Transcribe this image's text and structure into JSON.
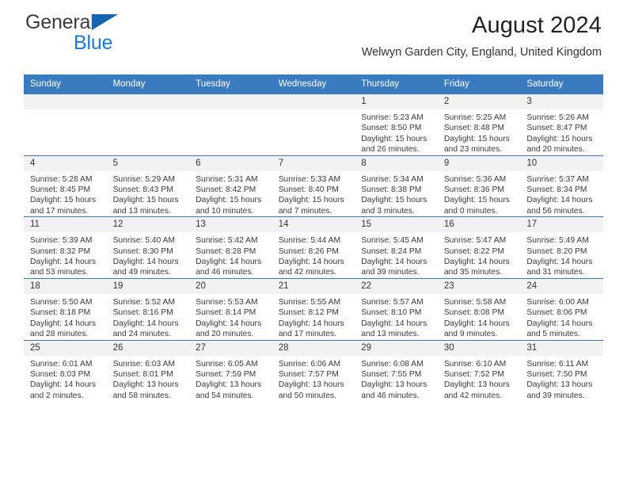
{
  "brand": {
    "word1": "General",
    "word2": "Blue",
    "flag_color": "#1565b0",
    "word2_color": "#1a7ad4"
  },
  "header": {
    "month_title": "August 2024",
    "location": "Welwyn Garden City, England, United Kingdom",
    "header_bg": "#3a7bbf"
  },
  "calendar": {
    "weekday_headers": [
      "Sunday",
      "Monday",
      "Tuesday",
      "Wednesday",
      "Thursday",
      "Friday",
      "Saturday"
    ],
    "weeks": [
      [
        {
          "day": "",
          "blank": true
        },
        {
          "day": "",
          "blank": true
        },
        {
          "day": "",
          "blank": true
        },
        {
          "day": "",
          "blank": true
        },
        {
          "day": "1",
          "sunrise": "Sunrise: 5:23 AM",
          "sunset": "Sunset: 8:50 PM",
          "daylight1": "Daylight: 15 hours",
          "daylight2": "and 26 minutes."
        },
        {
          "day": "2",
          "sunrise": "Sunrise: 5:25 AM",
          "sunset": "Sunset: 8:48 PM",
          "daylight1": "Daylight: 15 hours",
          "daylight2": "and 23 minutes."
        },
        {
          "day": "3",
          "sunrise": "Sunrise: 5:26 AM",
          "sunset": "Sunset: 8:47 PM",
          "daylight1": "Daylight: 15 hours",
          "daylight2": "and 20 minutes."
        }
      ],
      [
        {
          "day": "4",
          "sunrise": "Sunrise: 5:28 AM",
          "sunset": "Sunset: 8:45 PM",
          "daylight1": "Daylight: 15 hours",
          "daylight2": "and 17 minutes."
        },
        {
          "day": "5",
          "sunrise": "Sunrise: 5:29 AM",
          "sunset": "Sunset: 8:43 PM",
          "daylight1": "Daylight: 15 hours",
          "daylight2": "and 13 minutes."
        },
        {
          "day": "6",
          "sunrise": "Sunrise: 5:31 AM",
          "sunset": "Sunset: 8:42 PM",
          "daylight1": "Daylight: 15 hours",
          "daylight2": "and 10 minutes."
        },
        {
          "day": "7",
          "sunrise": "Sunrise: 5:33 AM",
          "sunset": "Sunset: 8:40 PM",
          "daylight1": "Daylight: 15 hours",
          "daylight2": "and 7 minutes."
        },
        {
          "day": "8",
          "sunrise": "Sunrise: 5:34 AM",
          "sunset": "Sunset: 8:38 PM",
          "daylight1": "Daylight: 15 hours",
          "daylight2": "and 3 minutes."
        },
        {
          "day": "9",
          "sunrise": "Sunrise: 5:36 AM",
          "sunset": "Sunset: 8:36 PM",
          "daylight1": "Daylight: 15 hours",
          "daylight2": "and 0 minutes."
        },
        {
          "day": "10",
          "sunrise": "Sunrise: 5:37 AM",
          "sunset": "Sunset: 8:34 PM",
          "daylight1": "Daylight: 14 hours",
          "daylight2": "and 56 minutes."
        }
      ],
      [
        {
          "day": "11",
          "sunrise": "Sunrise: 5:39 AM",
          "sunset": "Sunset: 8:32 PM",
          "daylight1": "Daylight: 14 hours",
          "daylight2": "and 53 minutes."
        },
        {
          "day": "12",
          "sunrise": "Sunrise: 5:40 AM",
          "sunset": "Sunset: 8:30 PM",
          "daylight1": "Daylight: 14 hours",
          "daylight2": "and 49 minutes."
        },
        {
          "day": "13",
          "sunrise": "Sunrise: 5:42 AM",
          "sunset": "Sunset: 8:28 PM",
          "daylight1": "Daylight: 14 hours",
          "daylight2": "and 46 minutes."
        },
        {
          "day": "14",
          "sunrise": "Sunrise: 5:44 AM",
          "sunset": "Sunset: 8:26 PM",
          "daylight1": "Daylight: 14 hours",
          "daylight2": "and 42 minutes."
        },
        {
          "day": "15",
          "sunrise": "Sunrise: 5:45 AM",
          "sunset": "Sunset: 8:24 PM",
          "daylight1": "Daylight: 14 hours",
          "daylight2": "and 39 minutes."
        },
        {
          "day": "16",
          "sunrise": "Sunrise: 5:47 AM",
          "sunset": "Sunset: 8:22 PM",
          "daylight1": "Daylight: 14 hours",
          "daylight2": "and 35 minutes."
        },
        {
          "day": "17",
          "sunrise": "Sunrise: 5:49 AM",
          "sunset": "Sunset: 8:20 PM",
          "daylight1": "Daylight: 14 hours",
          "daylight2": "and 31 minutes."
        }
      ],
      [
        {
          "day": "18",
          "sunrise": "Sunrise: 5:50 AM",
          "sunset": "Sunset: 8:18 PM",
          "daylight1": "Daylight: 14 hours",
          "daylight2": "and 28 minutes."
        },
        {
          "day": "19",
          "sunrise": "Sunrise: 5:52 AM",
          "sunset": "Sunset: 8:16 PM",
          "daylight1": "Daylight: 14 hours",
          "daylight2": "and 24 minutes."
        },
        {
          "day": "20",
          "sunrise": "Sunrise: 5:53 AM",
          "sunset": "Sunset: 8:14 PM",
          "daylight1": "Daylight: 14 hours",
          "daylight2": "and 20 minutes."
        },
        {
          "day": "21",
          "sunrise": "Sunrise: 5:55 AM",
          "sunset": "Sunset: 8:12 PM",
          "daylight1": "Daylight: 14 hours",
          "daylight2": "and 17 minutes."
        },
        {
          "day": "22",
          "sunrise": "Sunrise: 5:57 AM",
          "sunset": "Sunset: 8:10 PM",
          "daylight1": "Daylight: 14 hours",
          "daylight2": "and 13 minutes."
        },
        {
          "day": "23",
          "sunrise": "Sunrise: 5:58 AM",
          "sunset": "Sunset: 8:08 PM",
          "daylight1": "Daylight: 14 hours",
          "daylight2": "and 9 minutes."
        },
        {
          "day": "24",
          "sunrise": "Sunrise: 6:00 AM",
          "sunset": "Sunset: 8:06 PM",
          "daylight1": "Daylight: 14 hours",
          "daylight2": "and 5 minutes."
        }
      ],
      [
        {
          "day": "25",
          "sunrise": "Sunrise: 6:01 AM",
          "sunset": "Sunset: 8:03 PM",
          "daylight1": "Daylight: 14 hours",
          "daylight2": "and 2 minutes."
        },
        {
          "day": "26",
          "sunrise": "Sunrise: 6:03 AM",
          "sunset": "Sunset: 8:01 PM",
          "daylight1": "Daylight: 13 hours",
          "daylight2": "and 58 minutes."
        },
        {
          "day": "27",
          "sunrise": "Sunrise: 6:05 AM",
          "sunset": "Sunset: 7:59 PM",
          "daylight1": "Daylight: 13 hours",
          "daylight2": "and 54 minutes."
        },
        {
          "day": "28",
          "sunrise": "Sunrise: 6:06 AM",
          "sunset": "Sunset: 7:57 PM",
          "daylight1": "Daylight: 13 hours",
          "daylight2": "and 50 minutes."
        },
        {
          "day": "29",
          "sunrise": "Sunrise: 6:08 AM",
          "sunset": "Sunset: 7:55 PM",
          "daylight1": "Daylight: 13 hours",
          "daylight2": "and 46 minutes."
        },
        {
          "day": "30",
          "sunrise": "Sunrise: 6:10 AM",
          "sunset": "Sunset: 7:52 PM",
          "daylight1": "Daylight: 13 hours",
          "daylight2": "and 42 minutes."
        },
        {
          "day": "31",
          "sunrise": "Sunrise: 6:11 AM",
          "sunset": "Sunset: 7:50 PM",
          "daylight1": "Daylight: 13 hours",
          "daylight2": "and 39 minutes."
        }
      ]
    ]
  }
}
